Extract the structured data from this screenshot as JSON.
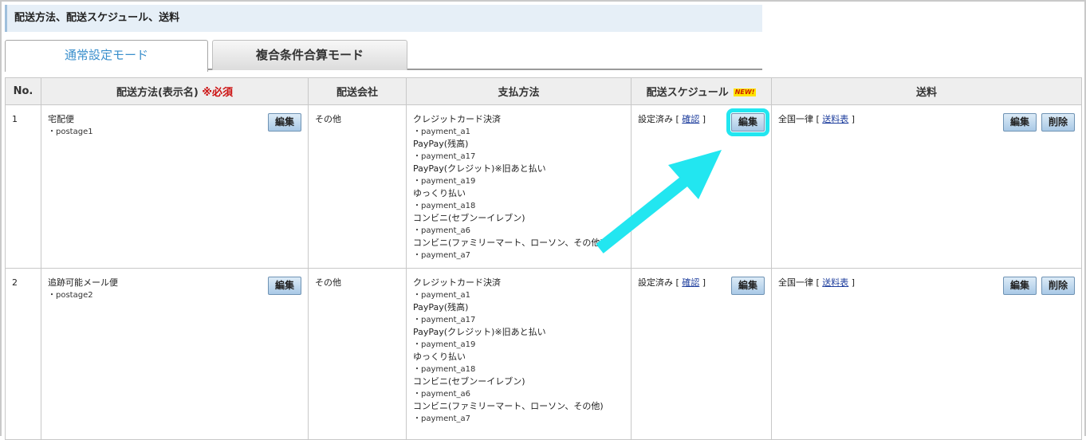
{
  "section_title": "配送方法、配送スケジュール、送料",
  "tabs": [
    {
      "label": "通常設定モード",
      "active": true
    },
    {
      "label": "複合条件合算モード",
      "active": false
    }
  ],
  "table": {
    "headers": {
      "no": "No.",
      "method": "配送方法(表示名)",
      "method_required": "※必須",
      "carrier": "配送会社",
      "payment": "支払方法",
      "schedule": "配送スケジュール",
      "schedule_badge": "NEW!",
      "shipping": "送料"
    },
    "rows": [
      {
        "no": "1",
        "method_name": "宅配便",
        "method_code": "・postage1",
        "method_edit": "編集",
        "carrier": "その他",
        "payments": [
          "クレジットカード決済",
          "・payment_a1",
          "PayPay(残高)",
          "・payment_a17",
          "PayPay(クレジット)※旧あと払い",
          "・payment_a19",
          "ゆっくり払い",
          "・payment_a18",
          "コンビニ(セブンーイレブン)",
          "・payment_a6",
          "コンビニ(ファミリーマート、ローソン、その他)",
          "・payment_a7"
        ],
        "schedule_status": "設定済み",
        "schedule_bracket_open": "[",
        "schedule_link": "確認",
        "schedule_bracket_close": "]",
        "schedule_edit": "編集",
        "shipping_text": "全国一律",
        "shipping_bracket_open": "[",
        "shipping_link": "送料表",
        "shipping_bracket_close": "]",
        "shipping_edit": "編集",
        "shipping_delete": "削除"
      },
      {
        "no": "2",
        "method_name": "追跡可能メール便",
        "method_code": "・postage2",
        "method_edit": "編集",
        "carrier": "その他",
        "payments": [
          "クレジットカード決済",
          "・payment_a1",
          "PayPay(残高)",
          "・payment_a17",
          "PayPay(クレジット)※旧あと払い",
          "・payment_a19",
          "ゆっくり払い",
          "・payment_a18",
          "コンビニ(セブンーイレブン)",
          "・payment_a6",
          "コンビニ(ファミリーマート、ローソン、その他)",
          "・payment_a7"
        ],
        "schedule_status": "設定済み",
        "schedule_bracket_open": "[",
        "schedule_link": "確認",
        "schedule_bracket_close": "]",
        "schedule_edit": "編集",
        "shipping_text": "全国一律",
        "shipping_bracket_open": "[",
        "shipping_link": "送料表",
        "shipping_bracket_close": "]",
        "shipping_edit": "編集",
        "shipping_delete": "削除"
      }
    ]
  },
  "colors": {
    "highlight": "#22e6f0",
    "required": "#cc1111",
    "active_tab_text": "#3a8fcc"
  },
  "icons": {
    "annotation": "arrow-annotation-icon"
  }
}
